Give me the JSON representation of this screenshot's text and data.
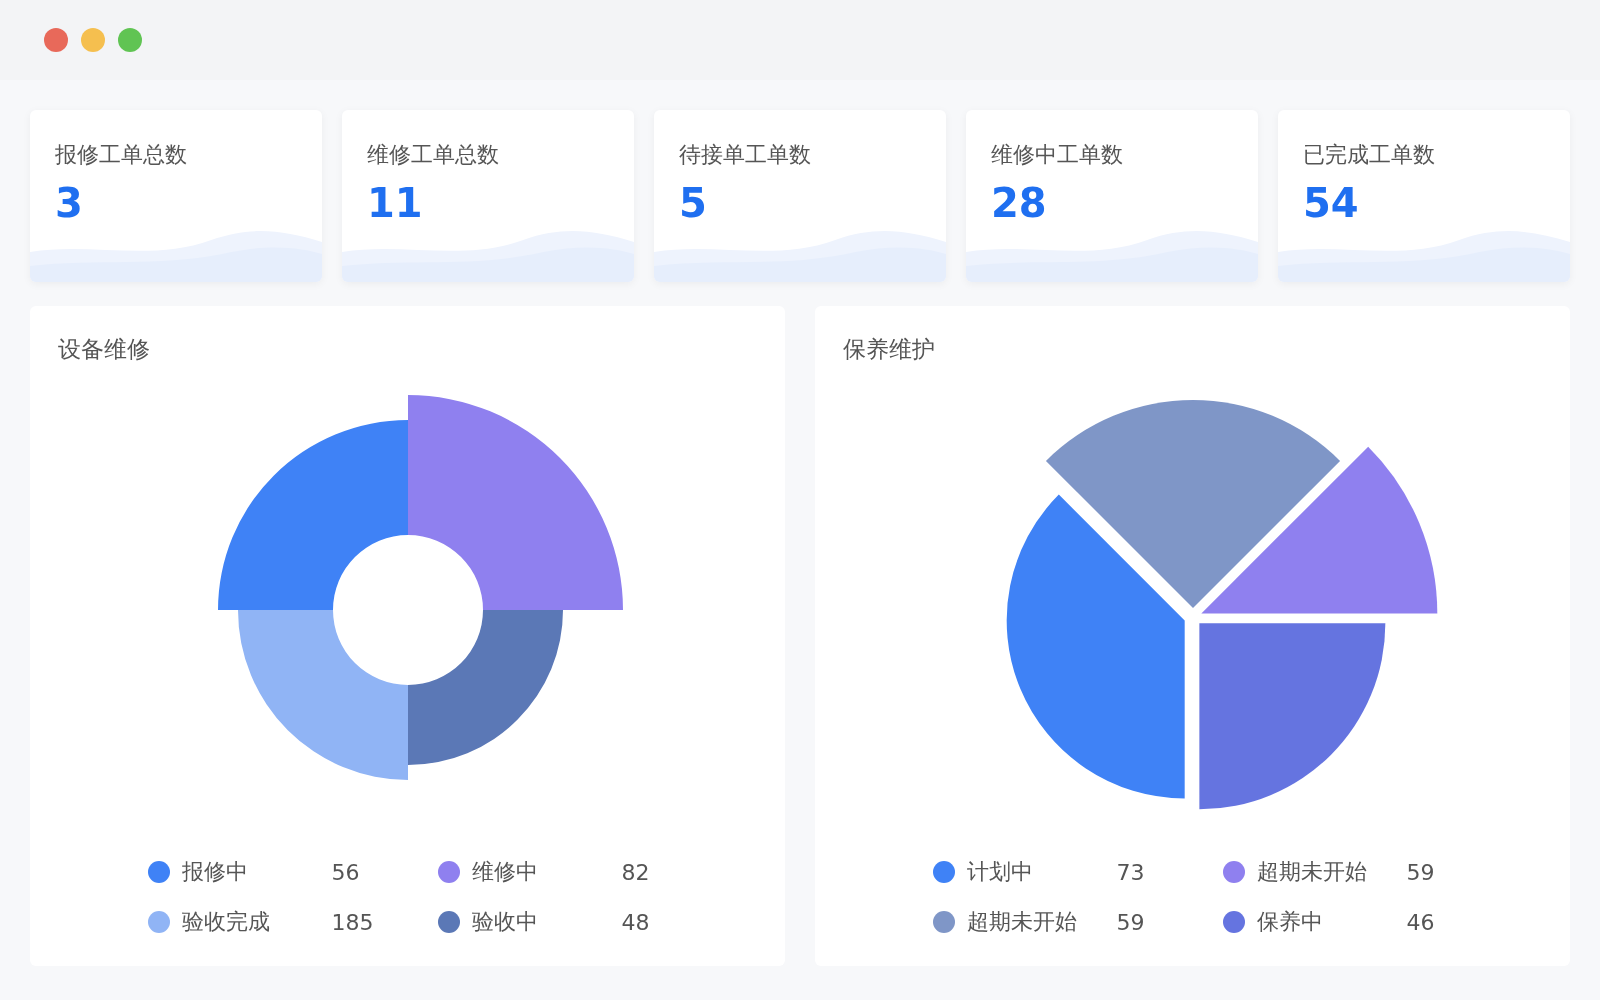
{
  "stats": [
    {
      "label": "报修工单总数",
      "value": "3"
    },
    {
      "label": "维修工单总数",
      "value": "11"
    },
    {
      "label": "待接单工单数",
      "value": "5"
    },
    {
      "label": "维修中工单数",
      "value": "28"
    },
    {
      "label": "已完成工单数",
      "value": "54"
    }
  ],
  "panels": [
    {
      "title": "设备维修",
      "kind": "rose",
      "legend": [
        {
          "label": "报修中",
          "value": "56",
          "color": "#3f82f6"
        },
        {
          "label": "维修中",
          "value": "82",
          "color": "#8f80ef"
        },
        {
          "label": "验收完成",
          "value": "185",
          "color": "#90b4f5"
        },
        {
          "label": "验收中",
          "value": "48",
          "color": "#5b78b6"
        }
      ]
    },
    {
      "title": "保养维护",
      "kind": "pie",
      "legend": [
        {
          "label": "计划中",
          "value": "73",
          "color": "#3f82f6"
        },
        {
          "label": "超期未开始",
          "value": "59",
          "color": "#8f80ef"
        },
        {
          "label": "超期未开始",
          "value": "59",
          "color": "#7f96c7"
        },
        {
          "label": "保养中",
          "value": "46",
          "color": "#6574e0"
        }
      ]
    }
  ]
}
